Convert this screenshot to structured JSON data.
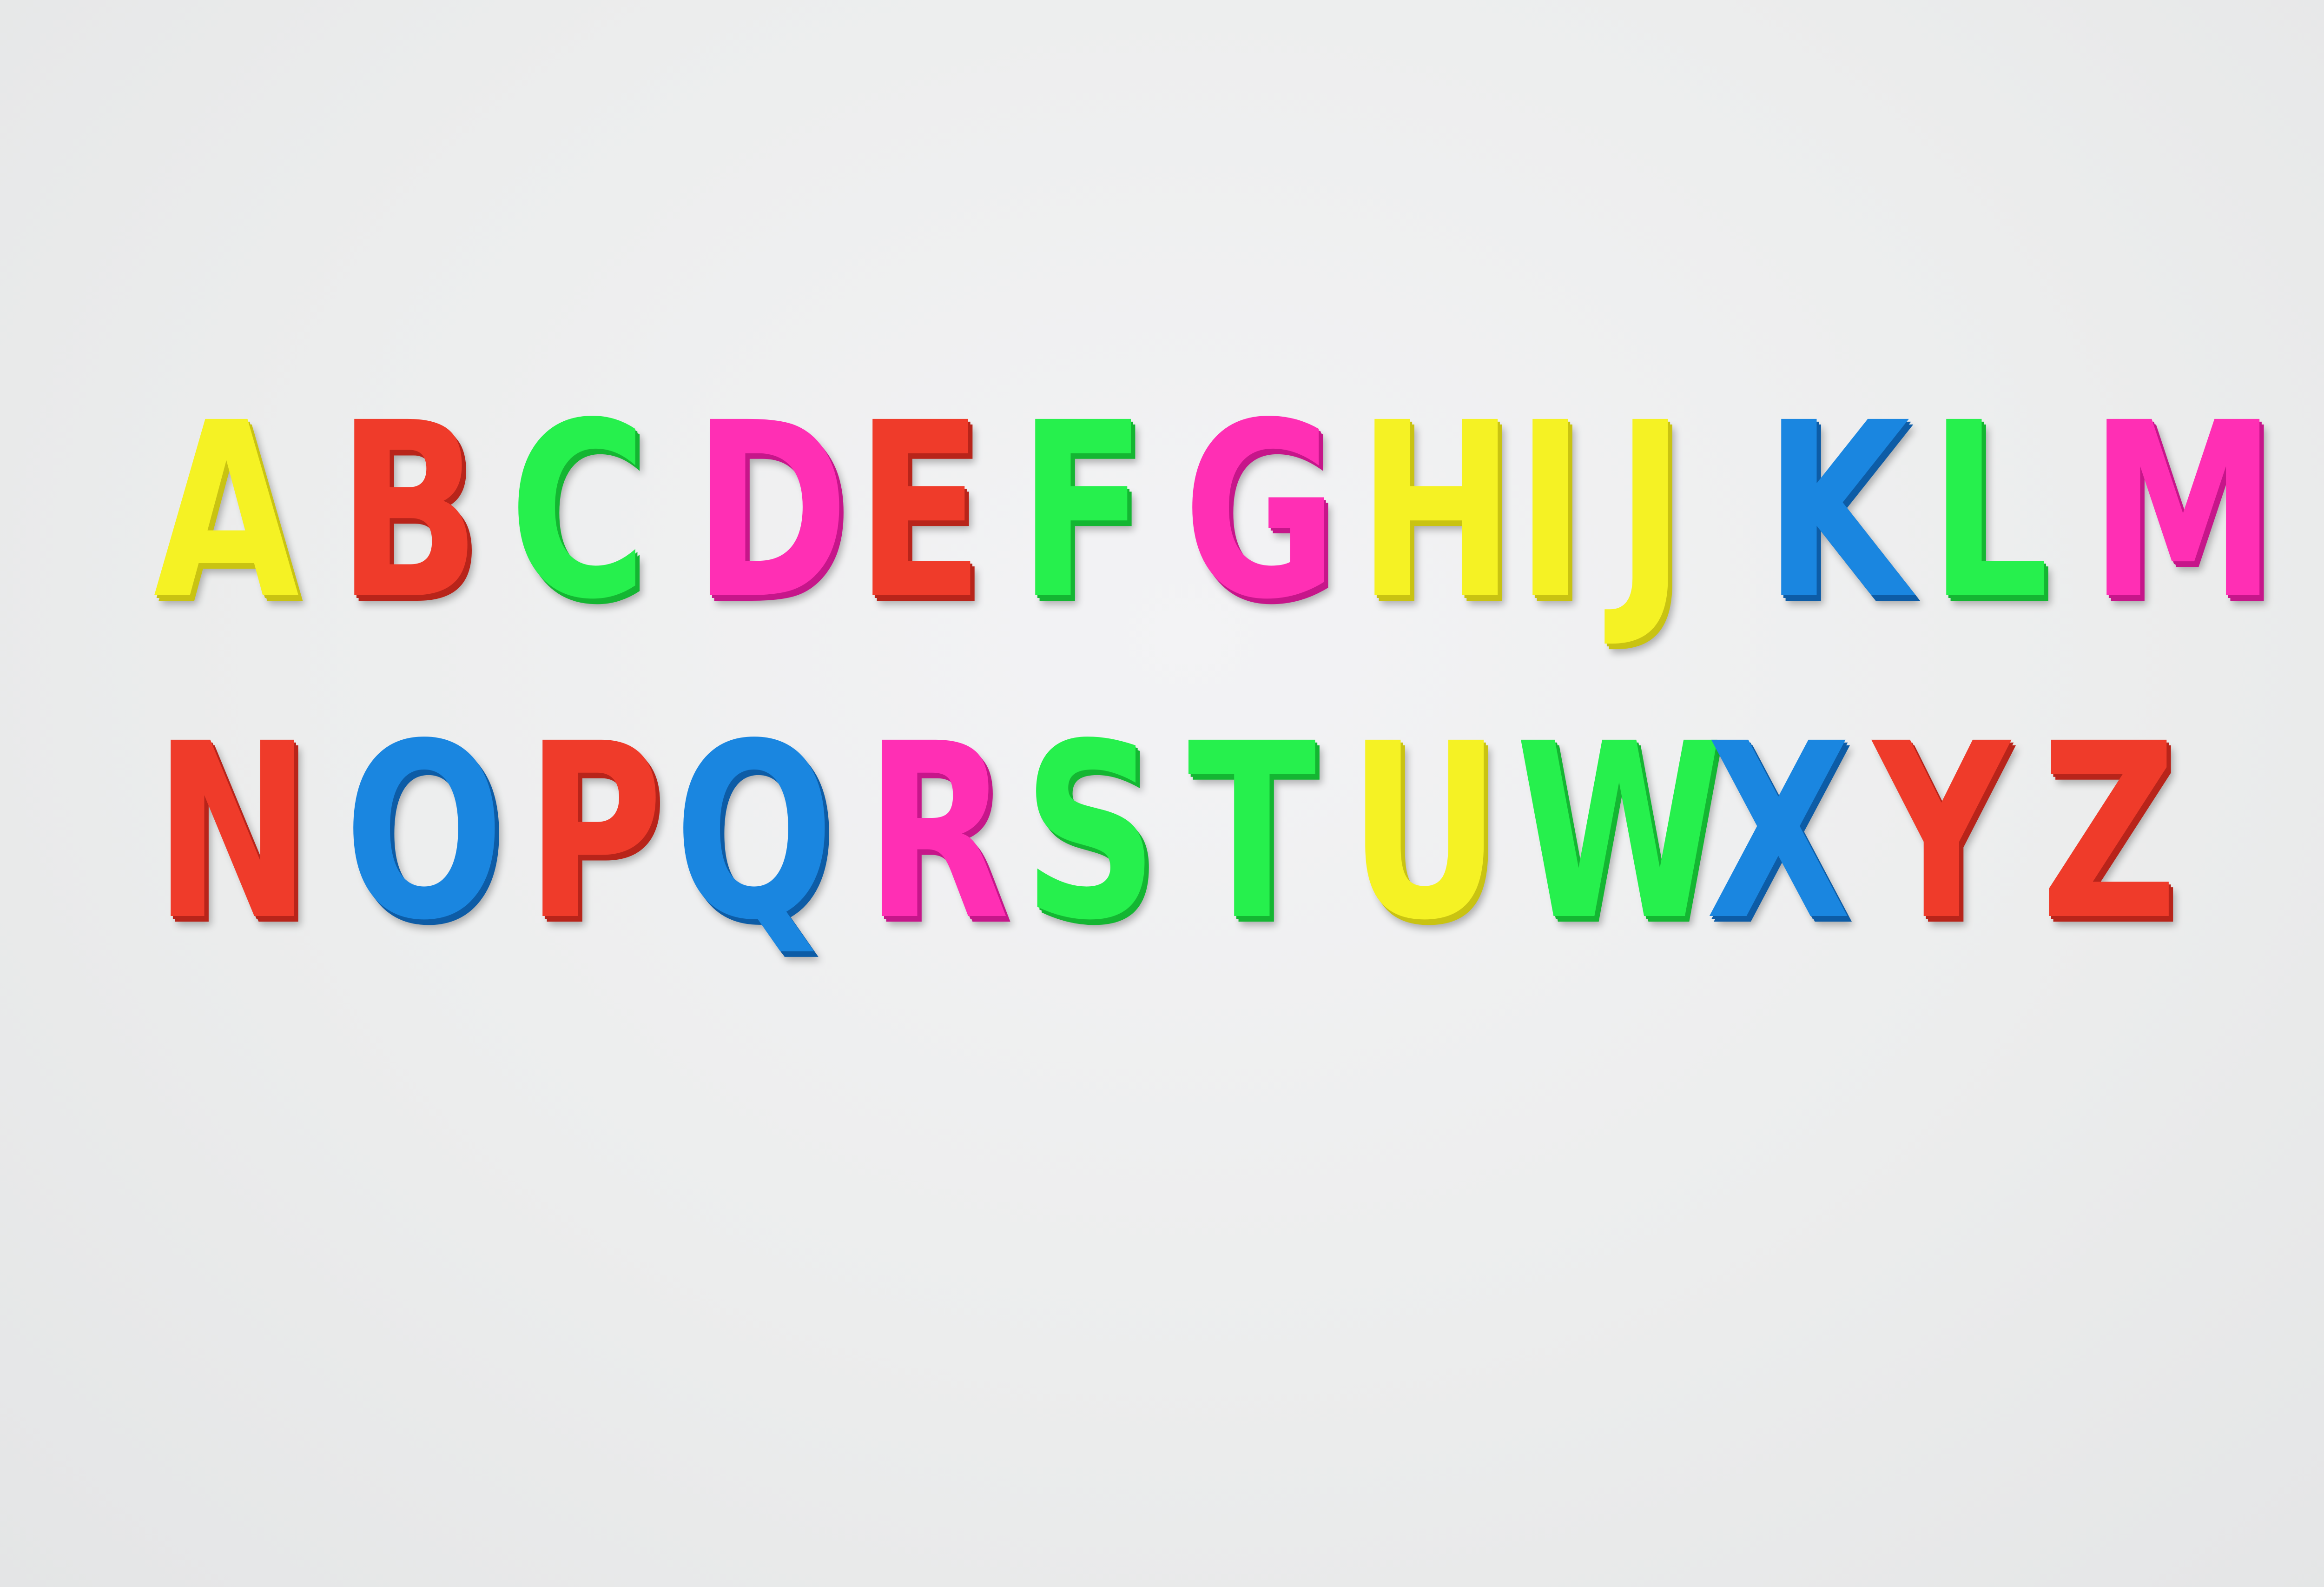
{
  "rows": [
    {
      "letters": [
        {
          "ch": "A",
          "color": "#f5f224",
          "shade": "#c9c312"
        },
        {
          "ch": "B",
          "color": "#ef3b2a",
          "shade": "#b8241a"
        },
        {
          "ch": "C",
          "color": "#26f04d",
          "shade": "#14b632"
        },
        {
          "ch": "D",
          "color": "#ff2fb4",
          "shade": "#c6168a"
        },
        {
          "ch": "E",
          "color": "#ef3b2a",
          "shade": "#b8241a"
        },
        {
          "ch": "F",
          "color": "#26f04d",
          "shade": "#14b632"
        },
        {
          "ch": "G",
          "color": "#ff2fb4",
          "shade": "#c6168a"
        },
        {
          "ch": "H",
          "color": "#f5f224",
          "shade": "#c9c312"
        },
        {
          "ch": "I",
          "color": "#f5f224",
          "shade": "#c9c312"
        },
        {
          "ch": "J",
          "color": "#f5f224",
          "shade": "#c9c312"
        },
        {
          "ch": "K",
          "color": "#1a86e0",
          "shade": "#0d5ca6"
        },
        {
          "ch": "L",
          "color": "#26f04d",
          "shade": "#14b632"
        },
        {
          "ch": "M",
          "color": "#ff2fb4",
          "shade": "#c6168a"
        }
      ]
    },
    {
      "letters": [
        {
          "ch": "N",
          "color": "#ef3b2a",
          "shade": "#b8241a"
        },
        {
          "ch": "O",
          "color": "#1a86e0",
          "shade": "#0d5ca6"
        },
        {
          "ch": "P",
          "color": "#ef3b2a",
          "shade": "#b8241a"
        },
        {
          "ch": "Q",
          "color": "#1a86e0",
          "shade": "#0d5ca6"
        },
        {
          "ch": "R",
          "color": "#ff2fb4",
          "shade": "#c6168a"
        },
        {
          "ch": "S",
          "color": "#26f04d",
          "shade": "#14b632"
        },
        {
          "ch": "T",
          "color": "#26f04d",
          "shade": "#14b632"
        },
        {
          "ch": "U",
          "color": "#f5f224",
          "shade": "#c9c312"
        },
        {
          "ch": "W",
          "color": "#26f04d",
          "shade": "#14b632"
        },
        {
          "ch": "X",
          "color": "#1a86e0",
          "shade": "#0d5ca6"
        },
        {
          "ch": "Y",
          "color": "#ef3b2a",
          "shade": "#b8241a"
        },
        {
          "ch": "Z",
          "color": "#ef3b2a",
          "shade": "#b8241a"
        }
      ]
    }
  ]
}
